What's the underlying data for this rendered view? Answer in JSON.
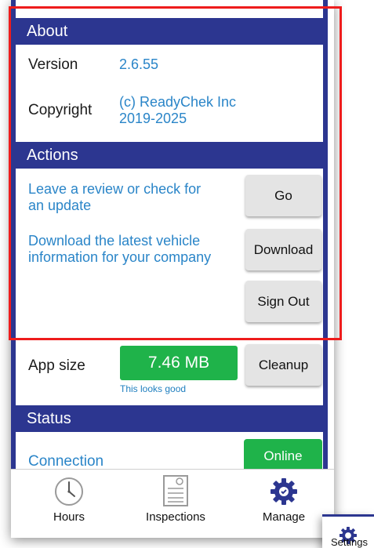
{
  "about": {
    "header": "About",
    "version_label": "Version",
    "version_value": "2.6.55",
    "copyright_label": "Copyright",
    "copyright_line1": "(c) ReadyChek Inc",
    "copyright_line2": "2019-2025"
  },
  "actions": {
    "header": "Actions",
    "review_line1": "Leave a review or check for",
    "review_line2": "an update",
    "go_label": "Go",
    "download_line1": "Download the latest vehicle",
    "download_line2": "information for your company",
    "download_label": "Download",
    "signout_label": "Sign Out"
  },
  "app_size": {
    "label": "App size",
    "value": "7.46 MB",
    "hint": "This looks good",
    "cleanup_label": "Cleanup"
  },
  "status": {
    "header": "Status",
    "connection_label": "Connection",
    "connection_value": "Online"
  },
  "tabs": [
    {
      "label": "Hours",
      "icon": "clock-icon"
    },
    {
      "label": "Inspections",
      "icon": "clipboard-icon"
    },
    {
      "label": "Manage",
      "icon": "gear-icon"
    }
  ],
  "floating_tab": {
    "label": "Settings",
    "icon": "gear-icon"
  },
  "colors": {
    "header_bg": "#2c3690",
    "link": "#2a85c8",
    "success": "#1fb34a",
    "highlight": "#ee1c1c"
  }
}
